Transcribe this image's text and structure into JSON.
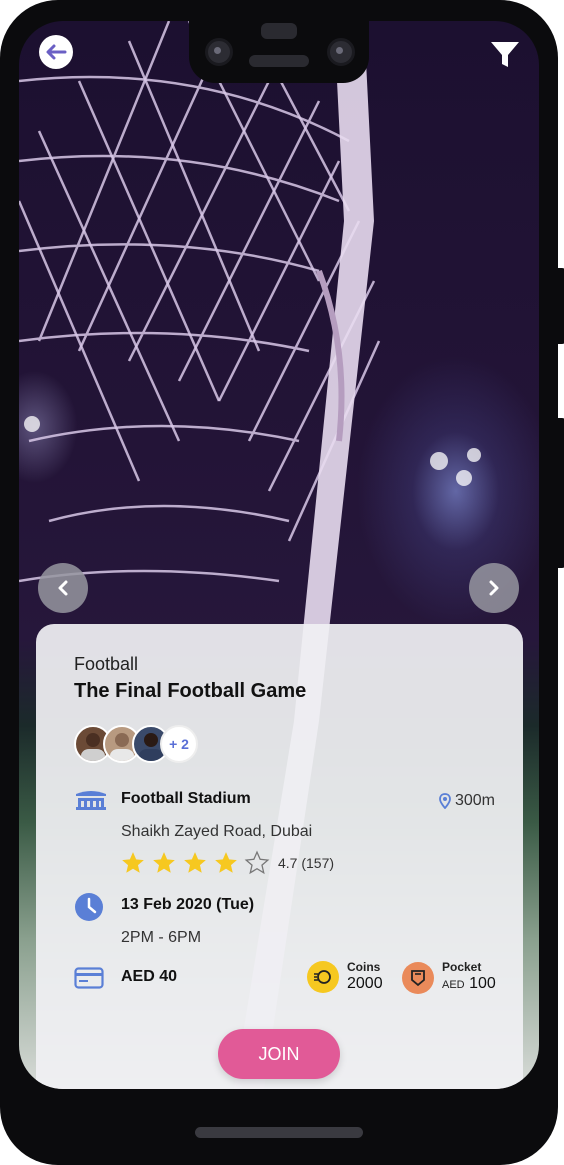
{
  "event": {
    "category": "Football",
    "title": "The Final Football Game",
    "participants_extra": "+ 2"
  },
  "venue": {
    "name": "Football Stadium",
    "distance": "300m",
    "address": "Shaikh Zayed Road, Dubai",
    "rating": 4.7,
    "rating_text": "4.7 (157)",
    "stars_filled": 4,
    "stars_total": 5
  },
  "schedule": {
    "date": "13 Feb 2020 (Tue)",
    "time": "2PM - 6PM"
  },
  "price": "AED 40",
  "wallet": {
    "coins_label": "Coins",
    "coins_value": "2000",
    "pocket_label": "Pocket",
    "pocket_unit": "AED",
    "pocket_value": "100"
  },
  "join_label": "JOIN",
  "icons": {
    "back": "arrow-left-icon",
    "filter": "filter-icon",
    "prev": "chevron-left-icon",
    "next": "chevron-right-icon",
    "stadium": "stadium-icon",
    "location": "location-pin-icon",
    "clock": "clock-icon",
    "card": "credit-card-icon",
    "coins": "coins-icon",
    "pocket": "pocket-icon"
  },
  "colors": {
    "accent": "#5a6fd6",
    "join": "#e15a97",
    "coins": "#f6c820",
    "pocket": "#ea8a5a",
    "star": "#f6c820"
  }
}
